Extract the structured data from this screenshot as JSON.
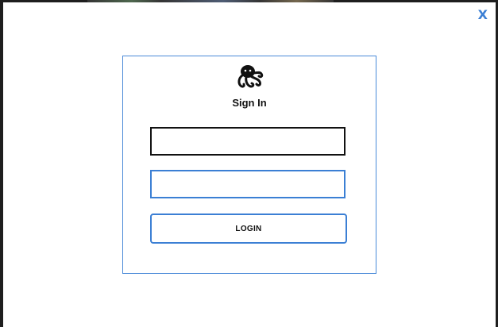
{
  "window": {
    "close_label": "X"
  },
  "login": {
    "title": "Sign In",
    "username_value": "",
    "password_value": "",
    "button_label": "LOGIN",
    "logo_icon": "octopus-icon"
  },
  "colors": {
    "accent": "#3b7fd4",
    "panel_border": "#4a8ad8",
    "text": "#111111"
  }
}
